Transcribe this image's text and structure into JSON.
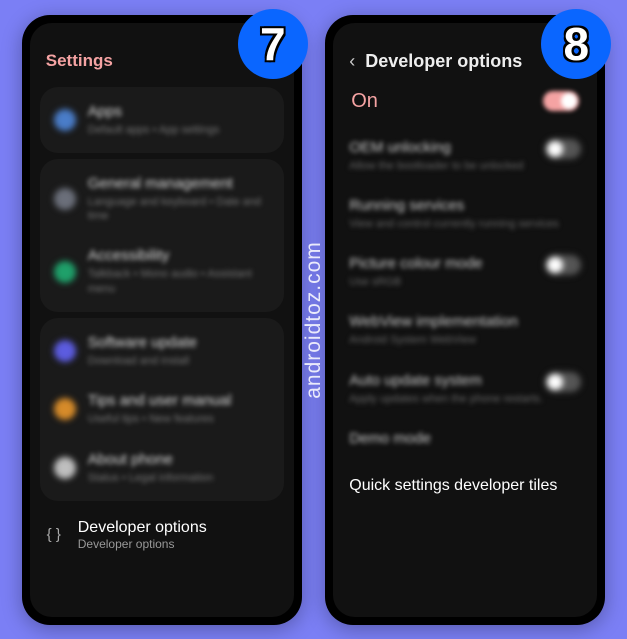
{
  "watermark": "androidtoz.com",
  "phones": {
    "left": {
      "badge": "7",
      "header": "Settings",
      "rows": {
        "apps": {
          "title": "Apps",
          "sub": "Default apps  •  App settings",
          "icon_color": "#4a7dc9"
        },
        "general": {
          "title": "General management",
          "sub": "Language and keyboard  •  Date and time",
          "icon_color": "#6b6f7a"
        },
        "accessibility": {
          "title": "Accessibility",
          "sub": "Talkback  •  Mono audio  •  Assistant menu",
          "icon_color": "#1fa06a"
        },
        "software": {
          "title": "Software update",
          "sub": "Download and install",
          "icon_color": "#5c5ce0"
        },
        "tips": {
          "title": "Tips and user manual",
          "sub": "Useful tips  •  New features",
          "icon_color": "#d68b2a"
        },
        "about": {
          "title": "About phone",
          "sub": "Status  •  Legal information",
          "icon_color": "#bfbfbf"
        },
        "dev": {
          "title": "Developer options",
          "sub": "Developer options"
        }
      }
    },
    "right": {
      "badge": "8",
      "header": "Developer options",
      "on_label": "On",
      "rows": {
        "oem": {
          "title": "OEM unlocking",
          "sub": "Allow the bootloader to be unlocked"
        },
        "running": {
          "title": "Running services",
          "sub": "View and control currently running services"
        },
        "picture": {
          "title": "Picture colour mode",
          "sub": "Use sRGB"
        },
        "webview": {
          "title": "WebView implementation",
          "sub": "Android System WebView"
        },
        "auto": {
          "title": "Auto update system",
          "sub": "Apply updates when the phone restarts."
        },
        "demo": {
          "title": "Demo mode",
          "sub": ""
        },
        "quick": {
          "title": "Quick settings developer tiles"
        }
      }
    }
  }
}
